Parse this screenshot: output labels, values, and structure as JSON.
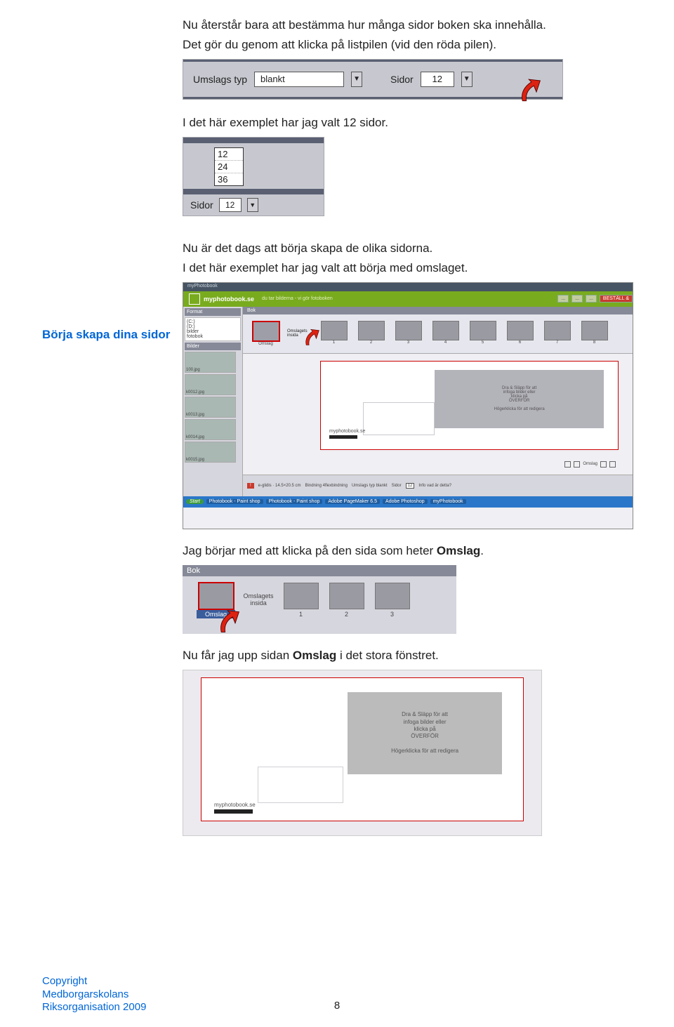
{
  "text": {
    "p1a": "Nu återstår bara att bestämma hur många sidor boken ska innehålla.",
    "p1b": "Det gör du genom att klicka på listpilen (vid den röda pilen).",
    "p2": "I det här exemplet har jag valt 12 sidor.",
    "sidebar": "Börja skapa dina sidor",
    "p3a": "Nu är det dags att börja skapa de olika sidorna.",
    "p3b": "I det här exemplet har jag valt att börja med omslaget.",
    "p4a": "Jag börjar med att klicka på den sida som heter ",
    "p4bold": "Omslag",
    "p4end": ".",
    "p5a": "Nu får jag upp sidan ",
    "p5bold": "Omslag",
    "p5b": " i det stora fönstret."
  },
  "fig1": {
    "label1": "Umslags typ",
    "value1": "blankt",
    "label2": "Sidor",
    "value2": "12"
  },
  "fig2": {
    "options": [
      "12",
      "24",
      "36"
    ],
    "label": "Sidor",
    "value": "12"
  },
  "fig3": {
    "winTitle": "myPhotobook",
    "brand": "myphotobook.se",
    "subtitle": "du tar bilderna - vi gör fotoboken",
    "btn_order": "BESTÄLL &",
    "leftTab1": "Format",
    "leftTab2": "Bilder",
    "folderLines": "(C:)\\n(D:)\\nbilder\\nfotobok",
    "thumbs": [
      "100.jpg",
      "k0012.jpg",
      "k0013.jpg",
      "k0014.jpg",
      "k0015.jpg"
    ],
    "pgBar": "Bok",
    "pg_sel": "Omslag",
    "pg_inside": "Omslagets insida",
    "pages": [
      "1",
      "2",
      "3",
      "4",
      "5",
      "6",
      "7",
      "8"
    ],
    "coverText": "Dra & Släpp för att\\ninfoga bilder eller\\nklicka på\\nÖVERFÖR\\n\\nHögerklicka för att redigera",
    "brandSmall": "myphotobook.se",
    "chk": "Omslag",
    "btm_size": "e-glidis\\nformat : 14.5 cm\\nformat : 20.5 cm",
    "btm_bind": "Bindning   4flexbindning",
    "btm_cov": "Umslags typ   blankt",
    "btm_sidor": "Sidor",
    "btm_sidor_v": "12",
    "btm_info": "Info   vad är detta?",
    "tb_start": "Start",
    "tb_items": [
      "Photobook - Paint shop",
      "Photobook - Paint shop",
      "Adobe PageMaker 6.5",
      "Adobe Photoshop",
      "myPhotobook"
    ]
  },
  "fig4": {
    "hdr": "Bok",
    "sel": "Omslag",
    "inside": "Omslagets insida",
    "pages": [
      "1",
      "2",
      "3"
    ]
  },
  "fig5": {
    "coverText": "Dra & Släpp för att\\ninfoga bilder eller\\nklicka på\\nÖVERFÖR\\n\\nHögerklicka för att redigera",
    "brand": "myphotobook.se"
  },
  "footer": {
    "l1": "Copyright",
    "l2": "Medborgarskolans",
    "l3": "Riksorganisation 2009"
  },
  "pageNumber": "8"
}
